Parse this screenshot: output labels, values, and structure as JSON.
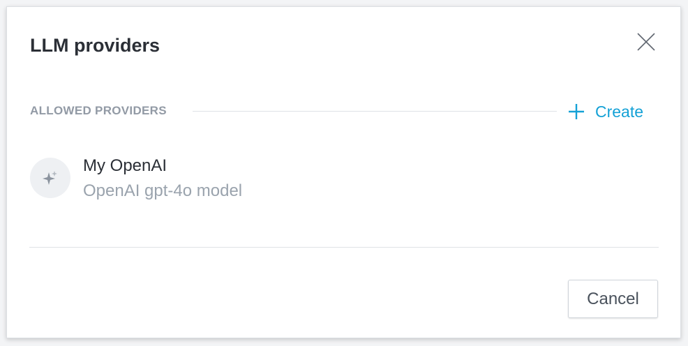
{
  "dialog": {
    "title": "LLM providers",
    "close_icon": "close-icon"
  },
  "section": {
    "label": "ALLOWED PROVIDERS",
    "create_label": "Create",
    "create_icon": "plus-icon"
  },
  "providers": [
    {
      "name": "My OpenAI",
      "model": "OpenAI gpt-4o model",
      "icon": "sparkle-icon"
    }
  ],
  "footer": {
    "cancel_label": "Cancel"
  },
  "colors": {
    "accent": "#14a1d6",
    "title_text": "#2b2f36",
    "muted_text": "#9aa3ad",
    "section_label": "#929aa5",
    "divider": "#dfe2e6",
    "avatar_bg": "#eef0f3"
  }
}
